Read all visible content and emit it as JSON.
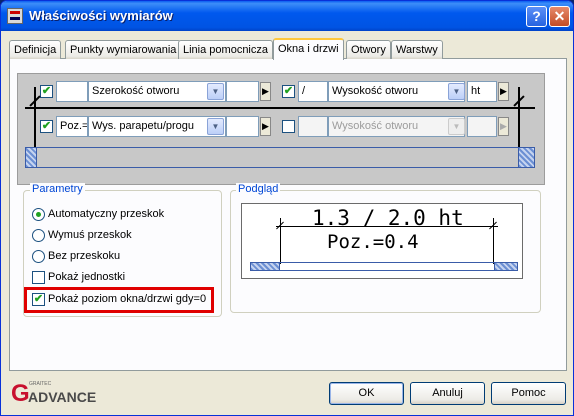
{
  "window": {
    "title": "Właściwości wymiarów"
  },
  "titlebar": {
    "help_label": "?",
    "close_label": "✕"
  },
  "tabs": [
    {
      "label": "Definicja"
    },
    {
      "label": "Punkty wymiarowania"
    },
    {
      "label": "Linia pomocnicza"
    },
    {
      "label": "Okna i drzwi"
    },
    {
      "label": "Otwory"
    },
    {
      "label": "Warstwy"
    }
  ],
  "active_tab": "Okna i drzwi",
  "row1": {
    "checkbox_checked": true,
    "prefix": "",
    "field": "Szerokość otworu",
    "checkbox2_checked": true,
    "separator": "/",
    "field2": "Wysokość otworu",
    "suffix": "ht"
  },
  "row2": {
    "checkbox_checked": true,
    "prefix": "Poz.=",
    "field": "Wys. parapetu/progu",
    "checkbox2_checked": false,
    "field2": "Wysokość otworu"
  },
  "parametry": {
    "title": "Parametry",
    "options": [
      {
        "label": "Automatyczny przeskok",
        "selected": true
      },
      {
        "label": "Wymuś przeskok",
        "selected": false
      },
      {
        "label": "Bez przeskoku",
        "selected": false
      }
    ],
    "checks": [
      {
        "label": "Pokaż jednostki",
        "checked": false
      },
      {
        "label": "Pokaż poziom okna/drzwi gdy=0",
        "checked": true
      }
    ]
  },
  "podglad": {
    "title": "Podgląd",
    "line1": "1.3 / 2.0 ht",
    "line2": "Poz.=0.4"
  },
  "logo": {
    "brand_small": "GRAITEC",
    "brand_word": "ADVANCE"
  },
  "buttons": {
    "ok": "OK",
    "cancel": "Anuluj",
    "help": "Pomoc"
  },
  "colors": {
    "highlight": "#e00000",
    "tab_accent": "#ffc83c",
    "titlebar": "#0054e3"
  }
}
